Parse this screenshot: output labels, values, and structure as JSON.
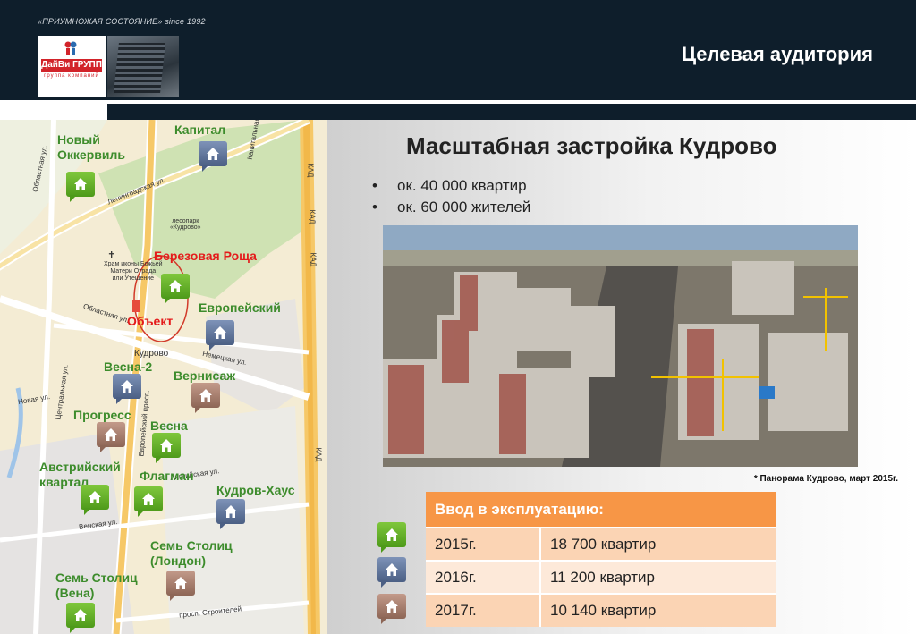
{
  "header": {
    "tagline": "«ПРИУМНОЖАЯ СОСТОЯНИЕ» since 1992",
    "logo_text": "ДайВи ГРУПП",
    "logo_sub": "группа компаний",
    "title": "Целевая аудитория"
  },
  "map": {
    "labels": {
      "novy_okkervil": "Новый\nОккервиль",
      "kapital": "Капитал",
      "berezovaya": "Березовая Роща",
      "obekt": "Объект",
      "evropeysky": "Европейский",
      "vesna2": "Весна-2",
      "vernisazh": "Вернисаж",
      "progress": "Прогресс",
      "vesna": "Весна",
      "avstriysky": "Австрийский\nквартал",
      "flagman": "Флагман",
      "kudrov_haus": "Кудров-Хаус",
      "sem_london": "Семь Столиц\n(Лондон)",
      "sem_vena": "Семь Столиц\n(Вена)"
    },
    "streets": {
      "leningradskaya": "Ленинградская ул.",
      "oblastnaya": "Областная ул.",
      "oblastnaya2": "Областная ул.",
      "kad1": "КАД",
      "kad2": "КАД",
      "kad3": "КАД",
      "kad4": "КАД",
      "kudrovo": "Кудрово",
      "nemetskaya": "Немецкая ул.",
      "tsentralnaya": "Центральная ул.",
      "evropeysky_pr": "Европейский просп.",
      "anglyskaya": "Английская ул.",
      "venskaya": "Венская ул.",
      "stroiteley": "просп. Строителей",
      "novaya": "Новая ул.",
      "lesopark": "лесопарк\n«Кудрово»",
      "church": "Храм иконы Божьей\nМатери Отрада\nили Утешение",
      "kapitalnaya": "Капитальная ул."
    }
  },
  "content": {
    "heading": "Масштабная застройка Кудрово",
    "bullets": [
      "ок. 40 000 квартир",
      "ок. 60 000 жителей"
    ],
    "caption": "* Панорама Кудрово, март 2015г.",
    "table": {
      "header": "Ввод в эксплуатацию:",
      "rows": [
        {
          "year": "2015г.",
          "value": "18 700 квартир",
          "pin": "green"
        },
        {
          "year": "2016г.",
          "value": "11 200 квартир",
          "pin": "blue"
        },
        {
          "year": "2017г.",
          "value": "10 140 квартир",
          "pin": "brown"
        }
      ]
    }
  },
  "colors": {
    "header_bg": "#0e1e2b",
    "table_header": "#f79646",
    "green_pin": "#4e9a1a",
    "blue_pin": "#4b5f84",
    "brown_pin": "#8d6656",
    "label_green": "#3d8c2c",
    "label_red": "#e41b1b"
  }
}
